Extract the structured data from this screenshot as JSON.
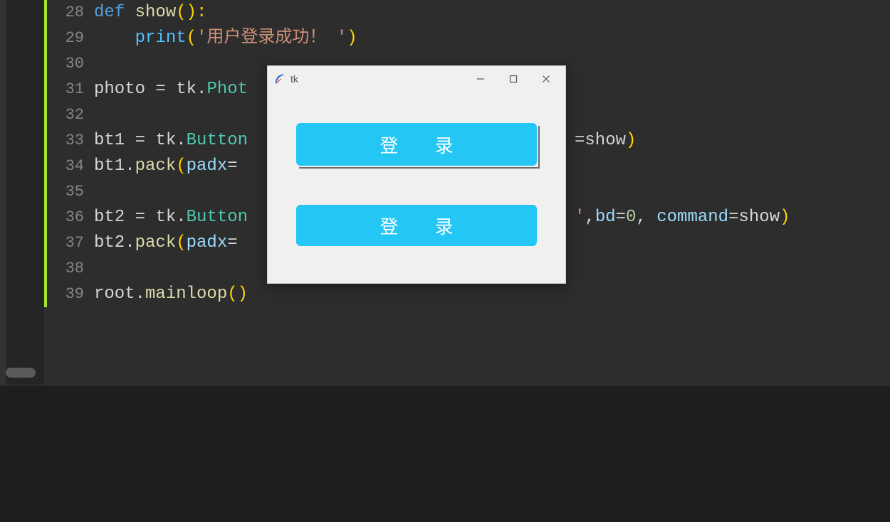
{
  "editor": {
    "lines": [
      {
        "num": "28",
        "tokens": [
          {
            "cls": "tok-kw",
            "pre": "",
            "t": "def "
          },
          {
            "cls": "tok-fn",
            "pre": "",
            "t": "show"
          },
          {
            "cls": "tok-paren",
            "pre": "",
            "t": "():"
          }
        ]
      },
      {
        "num": "29",
        "tokens": [
          {
            "cls": "tok-call",
            "pre": "    ",
            "t": "print"
          },
          {
            "cls": "tok-paren",
            "pre": "",
            "t": "("
          },
          {
            "cls": "tok-str",
            "pre": "",
            "t": "'用户登录成功！ '"
          },
          {
            "cls": "tok-paren",
            "pre": "",
            "t": ")"
          }
        ]
      },
      {
        "num": "30",
        "tokens": []
      },
      {
        "num": "31",
        "tokens": [
          {
            "cls": "tok-var",
            "pre": "",
            "t": "photo "
          },
          {
            "cls": "tok-op",
            "pre": "",
            "t": "= "
          },
          {
            "cls": "tok-var",
            "pre": "",
            "t": "tk."
          },
          {
            "cls": "tok-builtin",
            "pre": "",
            "t": "Phot"
          }
        ]
      },
      {
        "num": "32",
        "tokens": []
      },
      {
        "num": "33",
        "tokens": [
          {
            "cls": "tok-var",
            "pre": "",
            "t": "bt1 "
          },
          {
            "cls": "tok-op",
            "pre": "",
            "t": "= "
          },
          {
            "cls": "tok-var",
            "pre": "",
            "t": "tk."
          },
          {
            "cls": "tok-builtin",
            "pre": "",
            "t": "Button"
          }
        ],
        "right": [
          {
            "cls": "tok-op",
            "pre": "",
            "t": "="
          },
          {
            "cls": "tok-var",
            "pre": "",
            "t": "show"
          },
          {
            "cls": "tok-paren",
            "pre": "",
            "t": ")"
          }
        ]
      },
      {
        "num": "34",
        "tokens": [
          {
            "cls": "tok-var",
            "pre": "",
            "t": "bt1."
          },
          {
            "cls": "tok-fn",
            "pre": "",
            "t": "pack"
          },
          {
            "cls": "tok-paren",
            "pre": "",
            "t": "("
          },
          {
            "cls": "tok-param",
            "pre": "",
            "t": "padx"
          },
          {
            "cls": "tok-op",
            "pre": "",
            "t": "="
          }
        ]
      },
      {
        "num": "35",
        "tokens": []
      },
      {
        "num": "36",
        "tokens": [
          {
            "cls": "tok-var",
            "pre": "",
            "t": "bt2 "
          },
          {
            "cls": "tok-op",
            "pre": "",
            "t": "= "
          },
          {
            "cls": "tok-var",
            "pre": "",
            "t": "tk."
          },
          {
            "cls": "tok-builtin",
            "pre": "",
            "t": "Button"
          }
        ],
        "right": [
          {
            "cls": "tok-str",
            "pre": "",
            "t": "'"
          },
          {
            "cls": "tok-op",
            "pre": "",
            "t": ","
          },
          {
            "cls": "tok-param",
            "pre": "",
            "t": "bd"
          },
          {
            "cls": "tok-op",
            "pre": "",
            "t": "="
          },
          {
            "cls": "tok-num",
            "pre": "",
            "t": "0"
          },
          {
            "cls": "tok-op",
            "pre": "",
            "t": ", "
          },
          {
            "cls": "tok-param",
            "pre": "",
            "t": "command"
          },
          {
            "cls": "tok-op",
            "pre": "",
            "t": "="
          },
          {
            "cls": "tok-var",
            "pre": "",
            "t": "show"
          },
          {
            "cls": "tok-paren",
            "pre": "",
            "t": ")"
          }
        ]
      },
      {
        "num": "37",
        "tokens": [
          {
            "cls": "tok-var",
            "pre": "",
            "t": "bt2."
          },
          {
            "cls": "tok-fn",
            "pre": "",
            "t": "pack"
          },
          {
            "cls": "tok-paren",
            "pre": "",
            "t": "("
          },
          {
            "cls": "tok-param",
            "pre": "",
            "t": "padx"
          },
          {
            "cls": "tok-op",
            "pre": "",
            "t": "="
          }
        ]
      },
      {
        "num": "38",
        "tokens": []
      },
      {
        "num": "39",
        "tokens": [
          {
            "cls": "tok-var",
            "pre": "",
            "t": "root."
          },
          {
            "cls": "tok-fn",
            "pre": "",
            "t": "mainloop"
          },
          {
            "cls": "tok-paren",
            "pre": "",
            "t": "()"
          }
        ]
      }
    ]
  },
  "tk_window": {
    "title": "tk",
    "button1_label": "登  录",
    "button2_label": "登  录"
  }
}
